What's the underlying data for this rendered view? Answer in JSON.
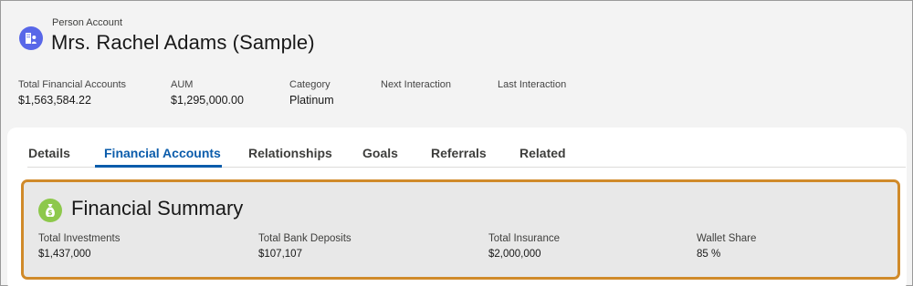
{
  "header": {
    "object_label": "Person Account",
    "title": "Mrs. Rachel Adams (Sample)",
    "icon": "person-account-icon",
    "icon_color": "#5867e8"
  },
  "highlights": [
    {
      "label": "Total Financial Accounts",
      "value": "$1,563,584.22"
    },
    {
      "label": "AUM",
      "value": "$1,295,000.00"
    },
    {
      "label": "Category",
      "value": "Platinum"
    },
    {
      "label": "Next Interaction",
      "value": ""
    },
    {
      "label": "Last Interaction",
      "value": ""
    }
  ],
  "tabs": [
    {
      "label": "Details",
      "active": false
    },
    {
      "label": "Financial Accounts",
      "active": true
    },
    {
      "label": "Relationships",
      "active": false
    },
    {
      "label": "Goals",
      "active": false
    },
    {
      "label": "Referrals",
      "active": false
    },
    {
      "label": "Related",
      "active": false
    }
  ],
  "summary": {
    "title": "Financial Summary",
    "icon": "money-bag-icon",
    "icon_color": "#8dc84b",
    "highlight_color": "#d08a2a",
    "fields": [
      {
        "label": "Total Investments",
        "value": "$1,437,000"
      },
      {
        "label": "Total Bank Deposits",
        "value": "$107,107"
      },
      {
        "label": "Total Insurance",
        "value": "$2,000,000"
      },
      {
        "label": "Wallet Share",
        "value": "85 %"
      }
    ]
  },
  "colors": {
    "accent": "#0b5cab",
    "page_background": "#f3f3f3"
  }
}
